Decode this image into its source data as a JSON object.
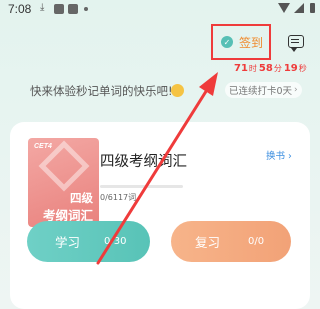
{
  "status_bar": {
    "time": "7:08"
  },
  "header": {
    "checkin_label": "签到",
    "countdown": {
      "hours": "71",
      "hour_unit": "时",
      "minutes": "58",
      "minute_unit": "分",
      "seconds": "19",
      "second_unit": "秒"
    }
  },
  "slogan": "快来体验秒记单词的快乐吧!",
  "streak": {
    "label": "已连续打卡0天"
  },
  "book": {
    "cover_tag": "CET4",
    "cover_line1": "四级",
    "cover_line2": "考纲词汇",
    "title": "四级考纲词汇",
    "change_label": "换书",
    "progress_text": "0/6117词",
    "progress_fraction": 0
  },
  "buttons": {
    "study_label": "学习",
    "study_count": "0/30",
    "review_label": "复习",
    "review_count": "0/0"
  },
  "colors": {
    "accent_teal": "#58c3b7",
    "accent_orange": "#f2a277",
    "countdown_red": "#ef3b3b",
    "checkin_orange": "#f08a2c",
    "link_blue": "#3d8fe0"
  }
}
